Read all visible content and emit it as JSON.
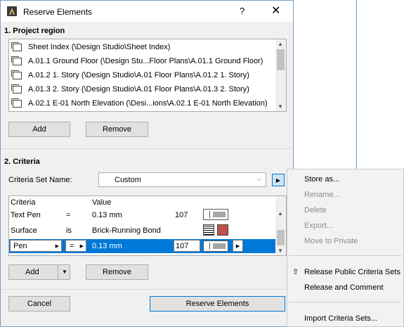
{
  "dialog": {
    "title": "Reserve Elements",
    "help": "?",
    "close": "✕"
  },
  "project_region": {
    "label": "1. Project region",
    "items": [
      "Sheet Index (\\Design Studio\\Sheet Index)",
      "A.01.1 Ground Floor (\\Design Stu...Floor Plans\\A.01.1 Ground Floor)",
      "A.01.2 1. Story (\\Design Studio\\A.01 Floor Plans\\A.01.2 1. Story)",
      "A.01.3 2. Story (\\Design Studio\\A.01 Floor Plans\\A.01.3 2. Story)",
      "A.02.1 E-01 North Elevation (\\Desi...ions\\A.02.1 E-01 North Elevation)"
    ],
    "add_label": "Add",
    "remove_label": "Remove"
  },
  "criteria": {
    "label": "2. Criteria",
    "set_name_label": "Criteria Set Name:",
    "set_name_value": "Custom",
    "headers": {
      "criteria": "Criteria",
      "value": "Value"
    },
    "rows": [
      {
        "criteria": "Text Pen",
        "op": "=",
        "value": "0.13 mm",
        "num": "107"
      },
      {
        "criteria": "Surface",
        "op": "is",
        "value": "Brick-Running Bond",
        "num": ""
      },
      {
        "criteria": "Pen",
        "op": "=",
        "value": "0.13 mm",
        "num": "107"
      }
    ],
    "add_label": "Add",
    "remove_label": "Remove"
  },
  "footer": {
    "cancel_label": "Cancel",
    "reserve_label": "Reserve Elements"
  },
  "menu": {
    "items": [
      {
        "label": "Store as...",
        "enabled": true
      },
      {
        "label": "Rename...",
        "enabled": false
      },
      {
        "label": "Delete",
        "enabled": false
      },
      {
        "label": "Export...",
        "enabled": false
      },
      {
        "label": "Move to Private",
        "enabled": false
      },
      {
        "label": "Release Public Criteria Sets",
        "enabled": true
      },
      {
        "label": "Release and Comment",
        "enabled": true
      },
      {
        "label": "Import Criteria Sets...",
        "enabled": true
      }
    ]
  },
  "colors": {
    "accent": "#0078d7",
    "surface_swatch": "#c0504d"
  }
}
